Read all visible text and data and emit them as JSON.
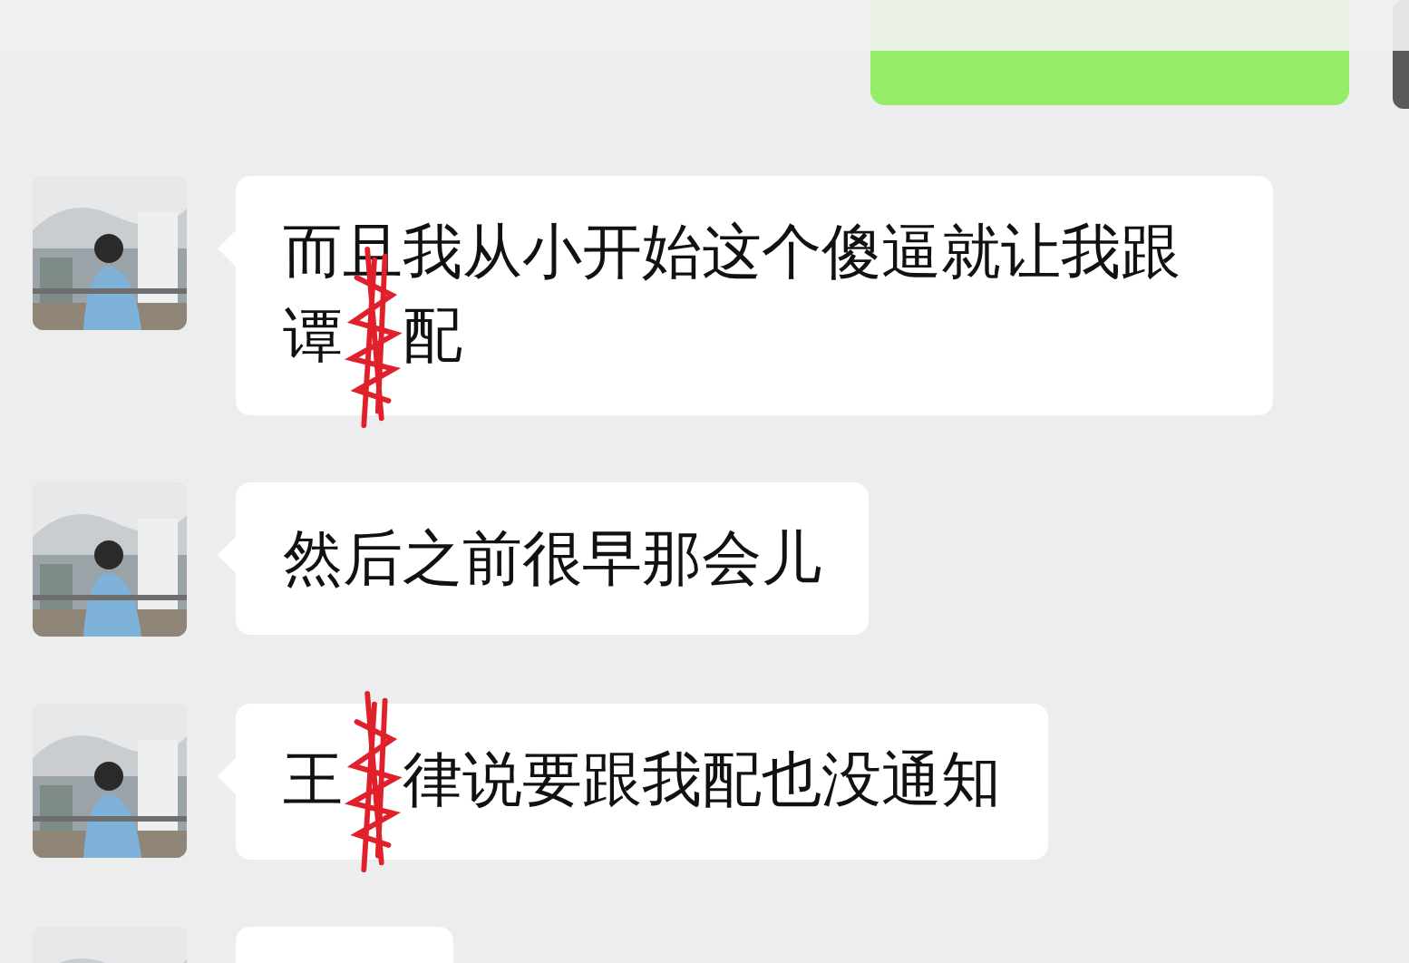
{
  "messages": [
    {
      "kind": "outgoing"
    },
    {
      "kind": "incoming",
      "before": "而且我从小开始这个傻逼就让我跟谭",
      "redacted": true,
      "after": "配"
    },
    {
      "kind": "incoming",
      "text": "然后之前很早那会儿"
    },
    {
      "kind": "incoming",
      "before": "王",
      "redacted": true,
      "after": "律说要跟我配也没通知"
    },
    {
      "kind": "incoming"
    }
  ]
}
